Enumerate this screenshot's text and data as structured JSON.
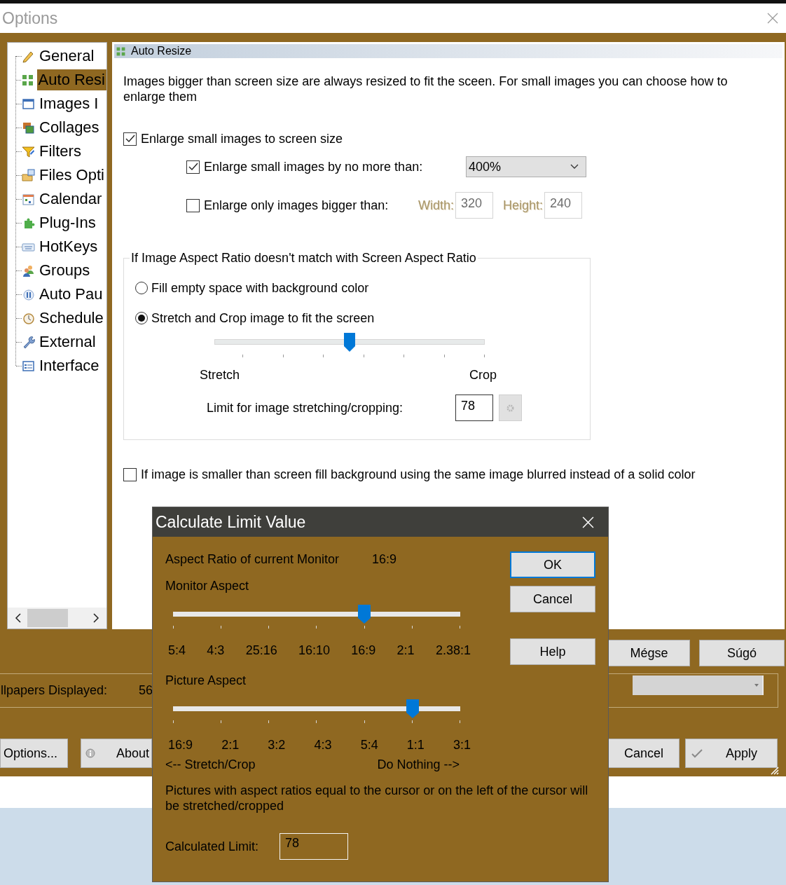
{
  "window": {
    "title": "Options"
  },
  "tree": {
    "items": [
      {
        "label": "General",
        "selected": false
      },
      {
        "label": "Auto Resi",
        "selected": true
      },
      {
        "label": "Images I",
        "selected": false
      },
      {
        "label": "Collages",
        "selected": false
      },
      {
        "label": "Filters",
        "selected": false
      },
      {
        "label": "Files Opti",
        "selected": false
      },
      {
        "label": "Calendar",
        "selected": false
      },
      {
        "label": "Plug-Ins",
        "selected": false
      },
      {
        "label": "HotKeys",
        "selected": false
      },
      {
        "label": "Groups",
        "selected": false
      },
      {
        "label": "Auto Pau",
        "selected": false
      },
      {
        "label": "Schedule",
        "selected": false
      },
      {
        "label": "External",
        "selected": false
      },
      {
        "label": "Interface",
        "selected": false
      }
    ]
  },
  "page": {
    "title": "Auto Resize",
    "intro": "Images bigger than screen size are always resized to fit the sceen. For small images you can choose how to enlarge them",
    "enlarge": {
      "label": "Enlarge small images to screen size",
      "checked": true
    },
    "max_enlarge": {
      "label": "Enlarge small images by no more than:",
      "checked": true,
      "value": "400%"
    },
    "min_size": {
      "label": "Enlarge only images bigger than:",
      "checked": false,
      "fields": [
        {
          "label": "Width:",
          "value": "320",
          "disabled": true
        },
        {
          "label": "Height:",
          "value": "240",
          "disabled": true
        }
      ]
    },
    "aspect_group": {
      "title": "If Image Aspect Ratio doesn't match with Screen Aspect Ratio",
      "options": [
        {
          "label": "Fill empty space with background color",
          "selected": false
        },
        {
          "label": "Stretch and Crop image to fit the screen",
          "selected": true
        }
      ],
      "slider": {
        "level": 0.5,
        "min_label": "Stretch",
        "max_label": "Crop"
      },
      "limit": {
        "label": "Limit for image stretching/cropping:",
        "value": "78"
      }
    },
    "blur": {
      "label": "If image is smaller than screen fill background using the same image blurred instead of a solid color",
      "checked": false
    }
  },
  "bottom": {
    "top_buttons": [
      "Mégse",
      "Súgó"
    ],
    "wallpapers": {
      "label": "llpapers Displayed:",
      "value": "56"
    },
    "buttons": [
      {
        "label": "Options...",
        "kind": "plain"
      },
      {
        "label": "About",
        "kind": "info"
      },
      {
        "label": "Cancel",
        "kind": "plain"
      },
      {
        "label": "Apply",
        "kind": "check"
      }
    ]
  },
  "dialog": {
    "title": "Calculate Limit Value",
    "monitor": {
      "label": "Aspect Ratio of current Monitor",
      "value": "16:9"
    },
    "sliders": [
      {
        "title": "Monitor Aspect",
        "level": 0.667,
        "ticks": [
          "5:4",
          "4:3",
          "25:16",
          "16:10",
          "16:9",
          "2:1",
          "2.38:1"
        ]
      },
      {
        "title": "Picture Aspect",
        "level": 0.833,
        "ticks": [
          "16:9",
          "2:1",
          "3:2",
          "4:3",
          "5:4",
          "1:1",
          "3:1"
        ]
      }
    ],
    "range_labels": [
      "<-- Stretch/Crop",
      "Do Nothing -->"
    ],
    "note": "Pictures with aspect ratios equal to the cursor or on the left of the cursor will be stretched/cropped",
    "result": {
      "label": "Calculated Limit:",
      "value": "78"
    },
    "buttons": [
      {
        "label": "OK",
        "default": true
      },
      {
        "label": "Cancel",
        "default": false
      },
      {
        "label": "Help",
        "default": false
      }
    ]
  }
}
